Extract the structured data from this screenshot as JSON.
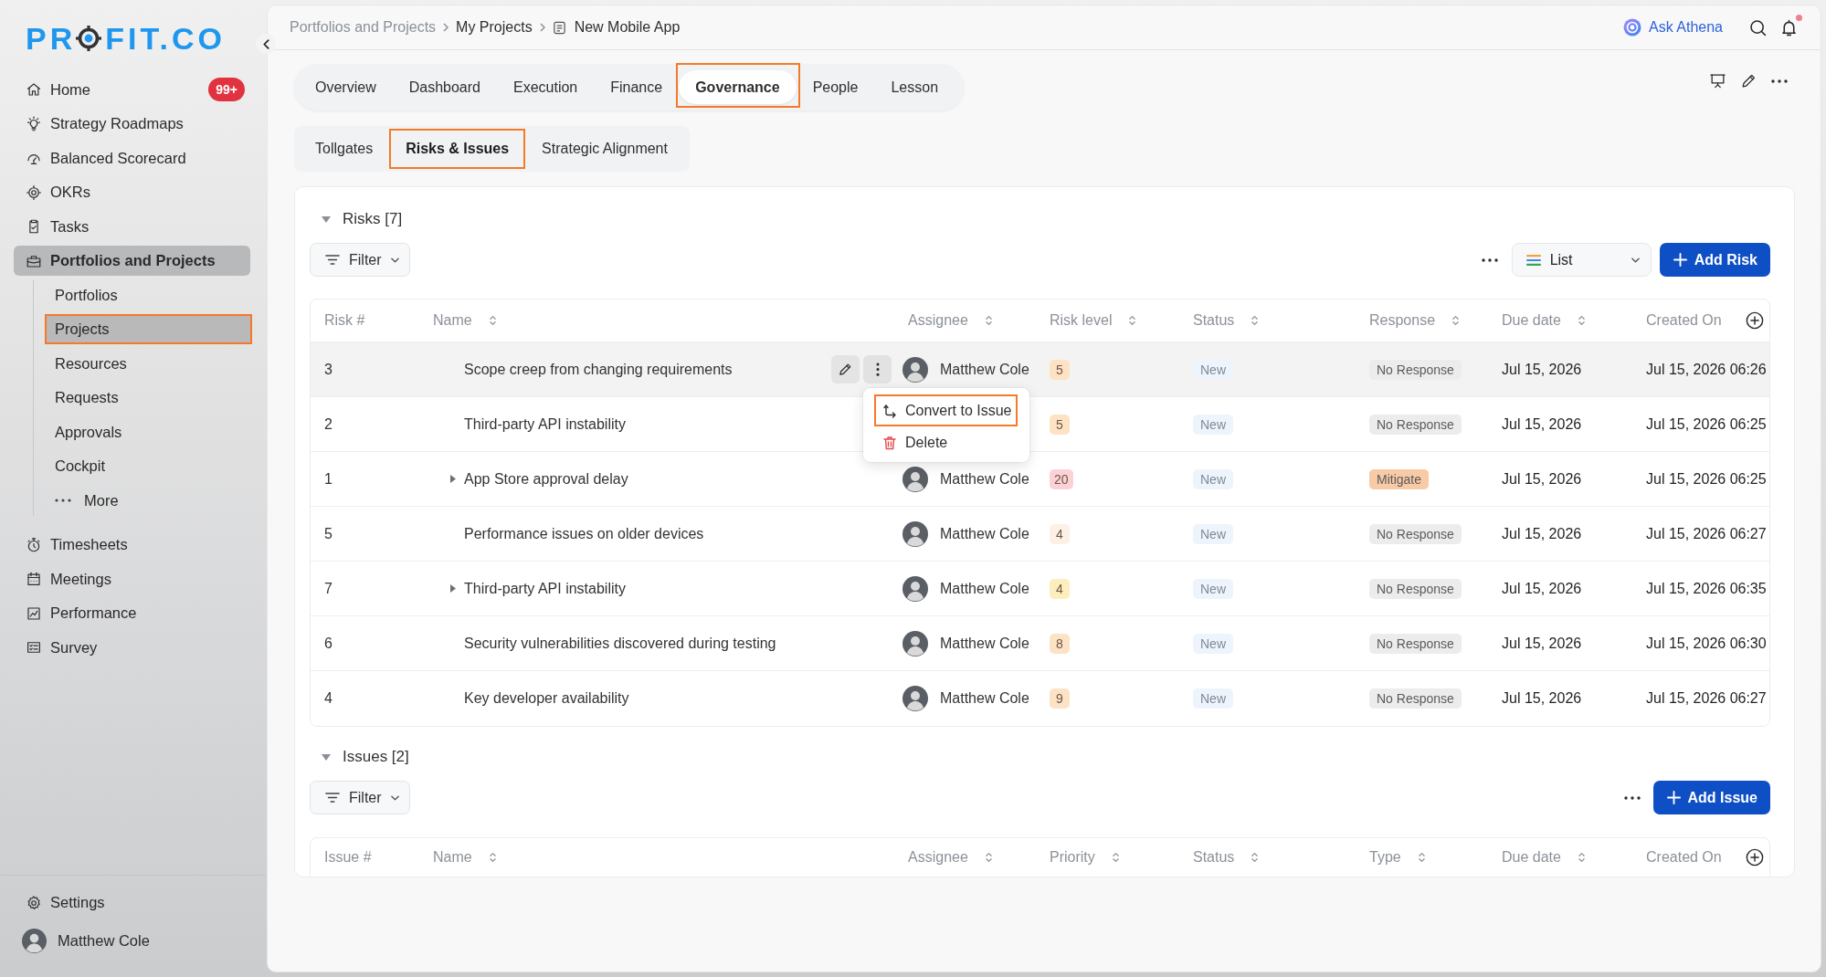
{
  "sidebar": {
    "logo": [
      "PR",
      "FIT.CO"
    ],
    "items": [
      {
        "label": "Home",
        "selected": false,
        "badge": "99+"
      },
      {
        "label": "Strategy Roadmaps",
        "selected": false
      },
      {
        "label": "Balanced Scorecard",
        "selected": false
      },
      {
        "label": "OKRs",
        "selected": false
      },
      {
        "label": "Tasks",
        "selected": false
      },
      {
        "label": "Portfolios and Projects",
        "selected": true,
        "children": [
          {
            "label": "Portfolios",
            "kind": "link",
            "selected": false,
            "outlined": false
          },
          {
            "label": "Projects",
            "kind": "link",
            "selected": true,
            "outlined": true
          },
          {
            "label": "Resources",
            "kind": "link",
            "selected": false,
            "outlined": false
          },
          {
            "label": "Requests",
            "kind": "link",
            "selected": false,
            "outlined": false
          },
          {
            "label": "Approvals",
            "kind": "link",
            "selected": false,
            "outlined": false
          },
          {
            "label": "Cockpit",
            "kind": "link",
            "selected": false,
            "outlined": false
          },
          {
            "label": "More",
            "kind": "more",
            "selected": false,
            "outlined": false
          }
        ]
      },
      {
        "label": "Timesheets",
        "selected": false
      },
      {
        "label": "Meetings",
        "selected": false
      },
      {
        "label": "Performance",
        "selected": false
      },
      {
        "label": "Survey",
        "selected": false
      }
    ],
    "settings": "Settings",
    "user": "Matthew Cole"
  },
  "header": {
    "breadcrumb": [
      "Portfolios and Projects",
      "My Projects",
      "New Mobile App"
    ],
    "assistant": "Ask Athena",
    "unread_notifications": true
  },
  "tabs": [
    {
      "label": "Overview",
      "selected": false,
      "outlined": false
    },
    {
      "label": "Dashboard",
      "selected": false,
      "outlined": false
    },
    {
      "label": "Execution",
      "selected": false,
      "outlined": false
    },
    {
      "label": "Finance",
      "selected": false,
      "outlined": false
    },
    {
      "label": "Governance",
      "selected": true,
      "outlined": true
    },
    {
      "label": "People",
      "selected": false,
      "outlined": false
    },
    {
      "label": "Lesson",
      "selected": false,
      "outlined": false
    }
  ],
  "subtabs": [
    {
      "label": "Tollgates",
      "selected": false,
      "outlined": false
    },
    {
      "label": "Risks & Issues",
      "selected": true,
      "outlined": true
    },
    {
      "label": "Strategic Alignment",
      "selected": false,
      "outlined": false
    }
  ],
  "risks": {
    "title": "Risks [7]",
    "expanded": true,
    "filter": "Filter",
    "view": "List",
    "add_button": "Add Risk",
    "columns": [
      {
        "label": "Risk #",
        "sortable": false
      },
      {
        "label": "Name",
        "sortable": true
      },
      {
        "label": "Assignee",
        "sortable": true
      },
      {
        "label": "Risk level",
        "sortable": true
      },
      {
        "label": "Status",
        "sortable": true
      },
      {
        "label": "Response",
        "sortable": true
      },
      {
        "label": "Due date",
        "sortable": true
      },
      {
        "label": "Created On",
        "sortable": false
      }
    ],
    "rows": [
      {
        "number": "3",
        "name": "Scope creep from changing requirements",
        "expandable": false,
        "highlighted": true,
        "menu_open": true,
        "assignee": "Matthew Cole",
        "risk_level": {
          "text": "5",
          "color": "#fde3c4"
        },
        "status": "New",
        "response": {
          "text": "No Response",
          "color": "#ececec"
        },
        "due_date": "Jul 15, 2026",
        "created_on": "Jul 15, 2026 06:26"
      },
      {
        "number": "2",
        "name": "Third-party API instability",
        "expandable": false,
        "highlighted": false,
        "menu_open": false,
        "risk_level": {
          "text": "5",
          "color": "#fde3c4"
        },
        "status": "New",
        "response": {
          "text": "No Response",
          "color": "#ececec"
        },
        "due_date": "Jul 15, 2026",
        "created_on": "Jul 15, 2026 06:25"
      },
      {
        "number": "1",
        "name": "App Store approval delay",
        "expandable": true,
        "highlighted": false,
        "menu_open": false,
        "assignee": "Matthew Cole",
        "risk_level": {
          "text": "20",
          "color": "#fcd2d6"
        },
        "status": "New",
        "response": {
          "text": "Mitigate",
          "color": "#f9caa6"
        },
        "due_date": "Jul 15, 2026",
        "created_on": "Jul 15, 2026 06:25"
      },
      {
        "number": "5",
        "name": "Performance issues on older devices",
        "expandable": false,
        "highlighted": false,
        "menu_open": false,
        "assignee": "Matthew Cole",
        "risk_level": {
          "text": "4",
          "color": "#fdf0e5"
        },
        "status": "New",
        "response": {
          "text": "No Response",
          "color": "#ececec"
        },
        "due_date": "Jul 15, 2026",
        "created_on": "Jul 15, 2026 06:27"
      },
      {
        "number": "7",
        "name": "Third-party API instability",
        "expandable": true,
        "highlighted": false,
        "menu_open": false,
        "assignee": "Matthew Cole",
        "risk_level": {
          "text": "4",
          "color": "#fcefbd"
        },
        "status": "New",
        "response": {
          "text": "No Response",
          "color": "#ececec"
        },
        "due_date": "Jul 15, 2026",
        "created_on": "Jul 15, 2026 06:35"
      },
      {
        "number": "6",
        "name": "Security vulnerabilities discovered during testing",
        "expandable": false,
        "highlighted": false,
        "menu_open": false,
        "assignee": "Matthew Cole",
        "risk_level": {
          "text": "8",
          "color": "#fde3c6"
        },
        "status": "New",
        "response": {
          "text": "No Response",
          "color": "#ececec"
        },
        "due_date": "Jul 15, 2026",
        "created_on": "Jul 15, 2026 06:30"
      },
      {
        "number": "4",
        "name": "Key developer availability",
        "expandable": false,
        "highlighted": false,
        "menu_open": false,
        "assignee": "Matthew Cole",
        "risk_level": {
          "text": "9",
          "color": "#fde3c6"
        },
        "status": "New",
        "response": {
          "text": "No Response",
          "color": "#ececec"
        },
        "due_date": "Jul 15, 2026",
        "created_on": "Jul 15, 2026 06:27"
      }
    ],
    "row_menu": [
      {
        "label": "Convert to Issue",
        "kind": "convert",
        "outlined": true
      },
      {
        "label": "Delete",
        "kind": "delete",
        "outlined": false
      }
    ]
  },
  "issues": {
    "title": "Issues [2]",
    "expanded": true,
    "filter": "Filter",
    "add_button": "Add Issue",
    "columns": [
      {
        "label": "Issue #",
        "sortable": false
      },
      {
        "label": "Name",
        "sortable": true
      },
      {
        "label": "Assignee",
        "sortable": true
      },
      {
        "label": "Priority",
        "sortable": true
      },
      {
        "label": "Status",
        "sortable": true
      },
      {
        "label": "Type",
        "sortable": true
      },
      {
        "label": "Due date",
        "sortable": true
      },
      {
        "label": "Created On",
        "sortable": false
      }
    ]
  }
}
